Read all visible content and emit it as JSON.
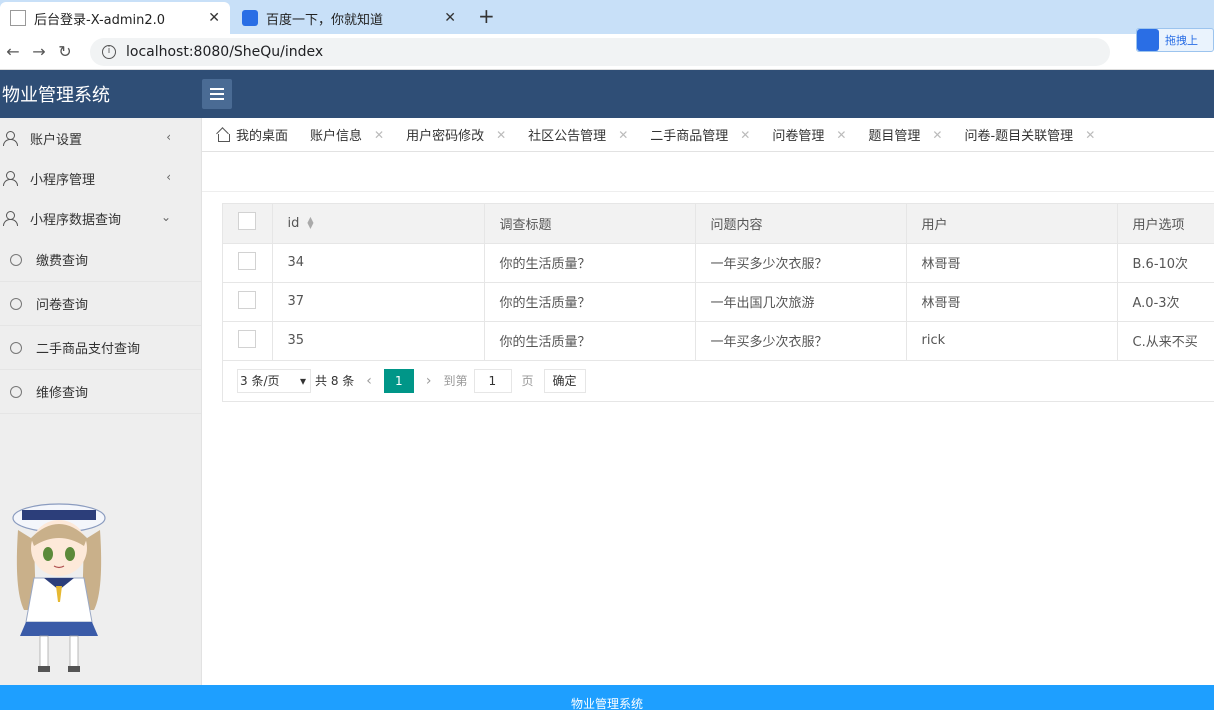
{
  "browser": {
    "tabs": [
      {
        "title": "后台登录-X-admin2.0",
        "active": true
      },
      {
        "title": "百度一下，你就知道",
        "active": false
      }
    ],
    "new_tab": "+",
    "close": "✕",
    "url": "localhost:8080/SheQu/index",
    "ext_label": "拖拽上"
  },
  "header": {
    "title": "物业管理系统"
  },
  "sidebar": {
    "items": [
      {
        "label": "账户设置",
        "chevron": "‹"
      },
      {
        "label": "小程序管理",
        "chevron": "‹"
      },
      {
        "label": "小程序数据查询",
        "chevron": "⌄"
      }
    ],
    "sub_items": [
      {
        "label": "缴费查询"
      },
      {
        "label": "问卷查询"
      },
      {
        "label": "二手商品支付查询"
      },
      {
        "label": "维修查询"
      }
    ]
  },
  "tabs": [
    {
      "label": "我的桌面",
      "closable": false
    },
    {
      "label": "账户信息",
      "closable": true
    },
    {
      "label": "用户密码修改",
      "closable": true
    },
    {
      "label": "社区公告管理",
      "closable": true
    },
    {
      "label": "二手商品管理",
      "closable": true
    },
    {
      "label": "问卷管理",
      "closable": true
    },
    {
      "label": "题目管理",
      "closable": true
    },
    {
      "label": "问卷-题目关联管理",
      "closable": true
    }
  ],
  "table": {
    "columns": [
      "id",
      "调查标题",
      "问题内容",
      "用户",
      "用户选项"
    ],
    "rows": [
      [
        "34",
        "你的生活质量？",
        "一年买多少次衣服？",
        "林哥哥",
        "B.6-10次"
      ],
      [
        "37",
        "你的生活质量？",
        "一年出国几次旅游",
        "林哥哥",
        "A.0-3次"
      ],
      [
        "35",
        "你的生活质量？",
        "一年买多少次衣服？",
        "rick",
        "C.从来不买"
      ]
    ]
  },
  "pager": {
    "page_size": "3 条/页",
    "total": "共 8 条",
    "current": "1",
    "goto_label": "到第",
    "goto_value": "1",
    "unit": "页",
    "confirm": "确定"
  },
  "footer": {
    "text": "物业管理系统"
  }
}
